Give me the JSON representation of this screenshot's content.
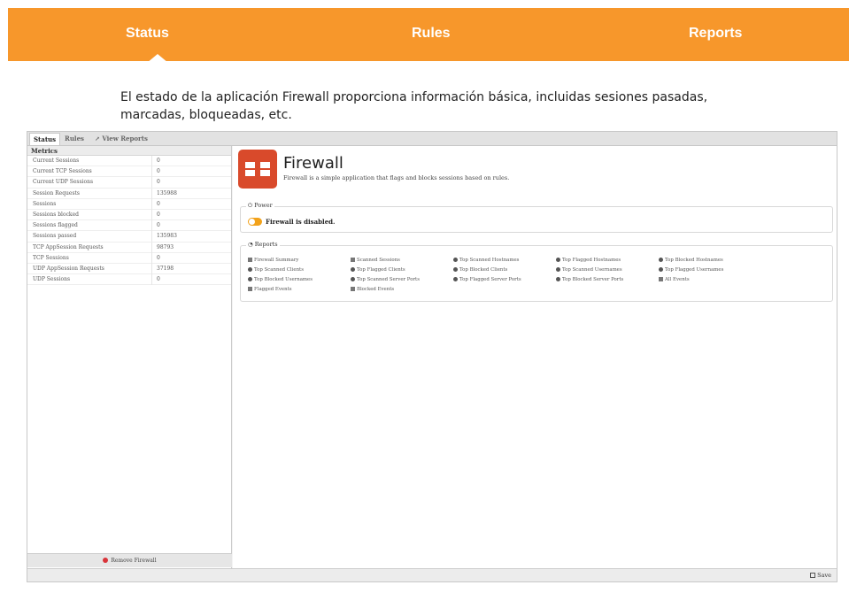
{
  "nav": {
    "tabs": [
      {
        "label": "Status"
      },
      {
        "label": "Rules"
      },
      {
        "label": "Reports"
      }
    ]
  },
  "description": "El estado de la aplicación Firewall proporciona información básica, incluidas sesiones pasadas, marcadas, bloqueadas, etc.",
  "app": {
    "tabs": [
      {
        "label": "Status"
      },
      {
        "label": "Rules"
      },
      {
        "label": "View Reports"
      }
    ],
    "metrics": {
      "header": "Metrics",
      "rows": [
        {
          "name": "Current Sessions",
          "value": "0"
        },
        {
          "name": "Current TCP Sessions",
          "value": "0"
        },
        {
          "name": "Current UDP Sessions",
          "value": "0"
        },
        {
          "name": "Session Requests",
          "value": "135988"
        },
        {
          "name": "Sessions",
          "value": "0"
        },
        {
          "name": "Sessions blocked",
          "value": "0"
        },
        {
          "name": "Sessions flagged",
          "value": "0"
        },
        {
          "name": "Sessions passed",
          "value": "135983"
        },
        {
          "name": "TCP AppSession Requests",
          "value": "98793"
        },
        {
          "name": "TCP Sessions",
          "value": "0"
        },
        {
          "name": "UDP AppSession Requests",
          "value": "37198"
        },
        {
          "name": "UDP Sessions",
          "value": "0"
        }
      ]
    },
    "remove_label": "Remove Firewall",
    "title": "Firewall",
    "subtitle": "Firewall is a simple application that flags and blocks sessions based on rules.",
    "power": {
      "legend": "Power",
      "status": "Firewall is disabled."
    },
    "reports": {
      "legend": "Reports",
      "links": [
        "Firewall Summary",
        "Scanned Sessions",
        "Top Scanned Hostnames",
        "Top Flagged Hostnames",
        "Top Blocked Hostnames",
        "Top Scanned Clients",
        "Top Flagged Clients",
        "Top Blocked Clients",
        "Top Scanned Usernames",
        "Top Flagged Usernames",
        "Top Blocked Usernames",
        "Top Scanned Server Ports",
        "Top Flagged Server Ports",
        "Top Blocked Server Ports",
        "All Events",
        "Flagged Events",
        "Blocked Events"
      ]
    },
    "save_label": "Save"
  }
}
